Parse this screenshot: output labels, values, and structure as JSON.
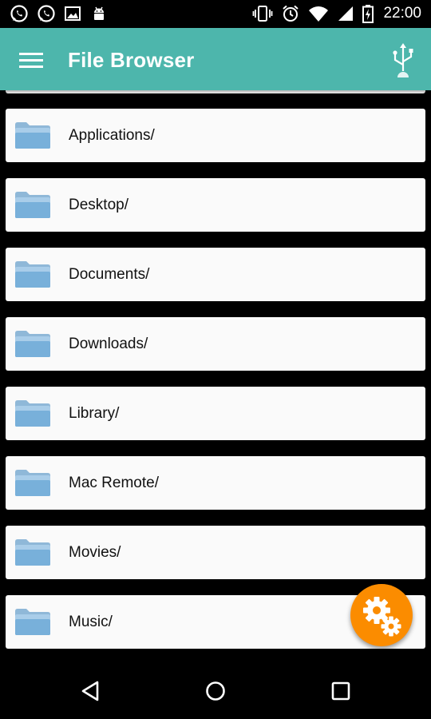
{
  "status_bar": {
    "time": "22:00",
    "left_icons": [
      "whatsapp-icon",
      "whatsapp-icon",
      "image-icon",
      "android-icon"
    ],
    "right_icons": [
      "vibrate-icon",
      "alarm-icon",
      "wifi-icon",
      "signal-icon",
      "battery-icon"
    ]
  },
  "app_bar": {
    "title": "File Browser",
    "background": "#4db6ac",
    "menu_icon": "hamburger-menu-icon",
    "action_icon": "usb-icon"
  },
  "folders": [
    {
      "name": "Applications/"
    },
    {
      "name": "Desktop/"
    },
    {
      "name": "Documents/"
    },
    {
      "name": "Downloads/"
    },
    {
      "name": "Library/"
    },
    {
      "name": "Mac Remote/"
    },
    {
      "name": "Movies/"
    },
    {
      "name": "Music/"
    }
  ],
  "folder_icon": "folder-icon",
  "fab": {
    "icon": "gears-icon",
    "color": "#fb8c00"
  },
  "nav_bar": {
    "buttons": [
      "back-icon",
      "home-icon",
      "recents-icon"
    ]
  }
}
